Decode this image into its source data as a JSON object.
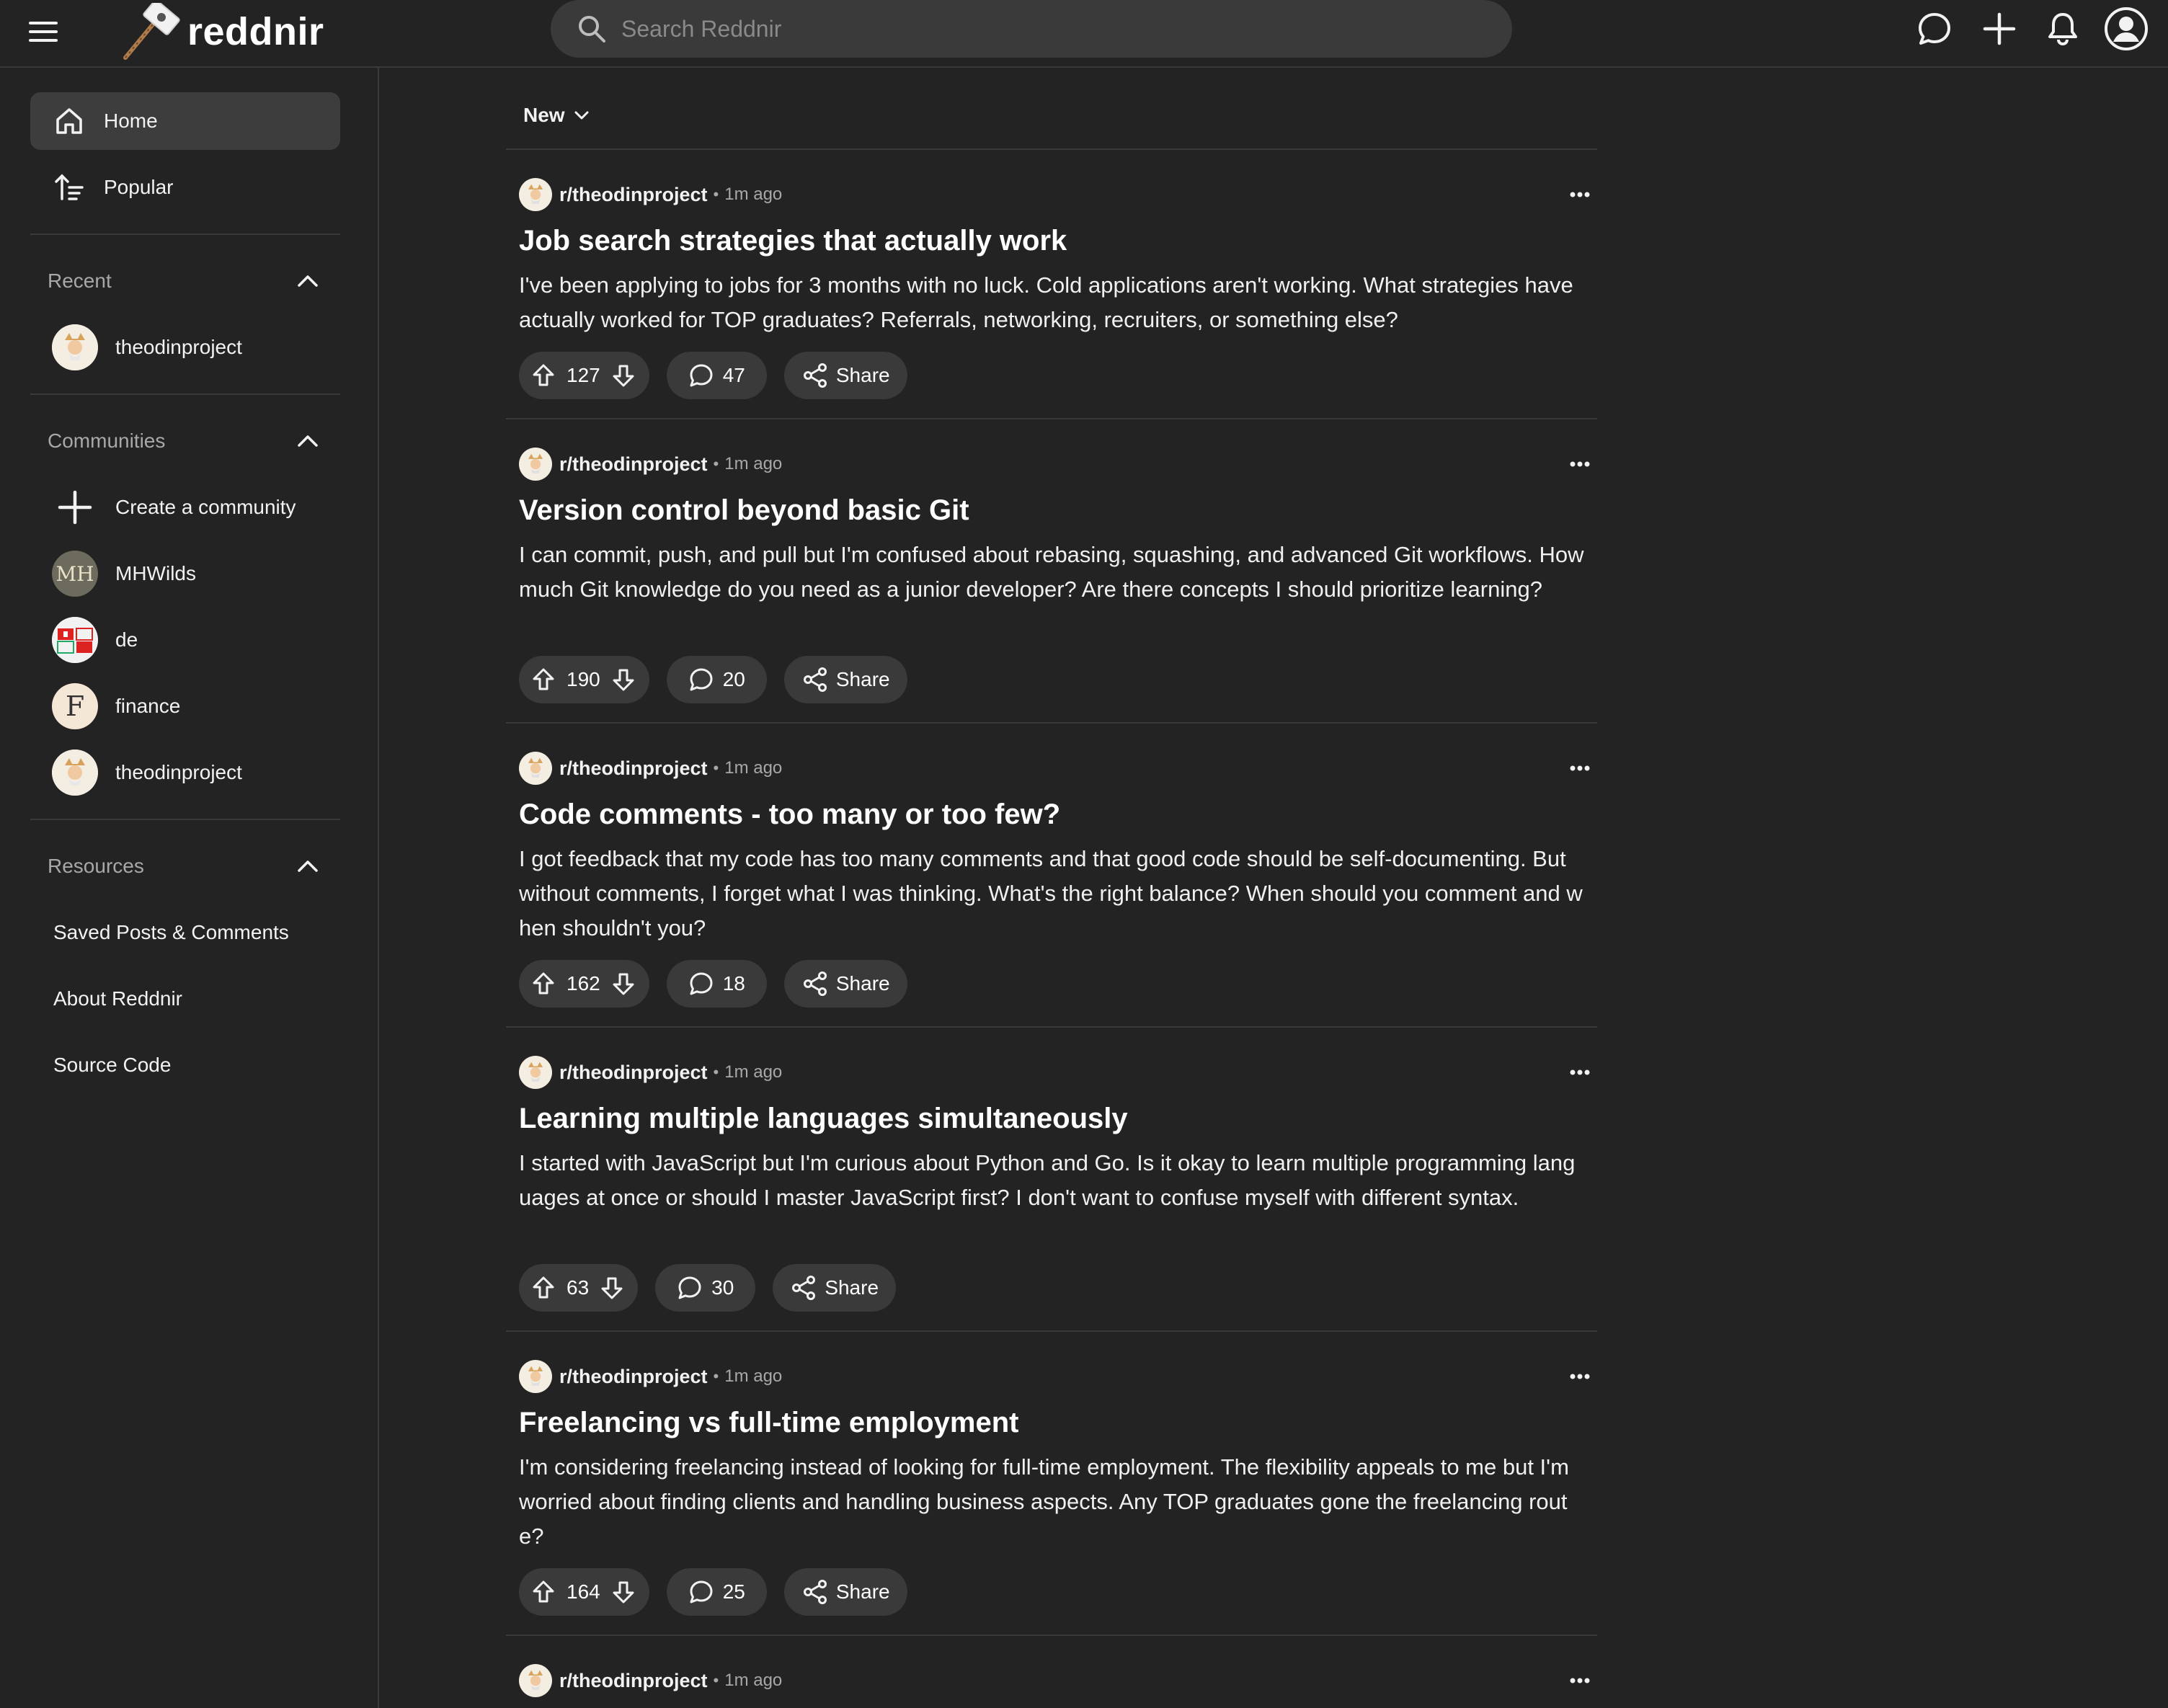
{
  "app": {
    "name": "reddnir"
  },
  "search": {
    "placeholder": "Search Reddnir"
  },
  "sidebar": {
    "nav": [
      {
        "label": "Home",
        "icon": "home-icon",
        "active": true
      },
      {
        "label": "Popular",
        "icon": "popular-icon",
        "active": false
      }
    ],
    "recent": {
      "heading": "Recent",
      "items": [
        {
          "label": "theodinproject",
          "avatar": "odin-avatar"
        }
      ]
    },
    "communities": {
      "heading": "Communities",
      "create_label": "Create a community",
      "items": [
        {
          "label": "MHWilds",
          "avatar_text": "MH"
        },
        {
          "label": "de",
          "avatar": "de-avatar"
        },
        {
          "label": "finance",
          "avatar_text": "F"
        },
        {
          "label": "theodinproject",
          "avatar": "odin-avatar"
        }
      ]
    },
    "resources": {
      "heading": "Resources",
      "items": [
        {
          "label": "Saved Posts & Comments"
        },
        {
          "label": "About Reddnir"
        },
        {
          "label": "Source Code"
        }
      ]
    }
  },
  "feed": {
    "sort_label": "New",
    "posts": [
      {
        "subreddit": "r/theodinproject",
        "time": "1m ago",
        "title": "Job search strategies that actually work",
        "body": "I've been applying to jobs for 3 months with no luck. Cold applications aren't working. What strategies have actually worked for TOP graduates? Referrals, networking, recruiters, or something else?",
        "votes": "127",
        "comments": "47",
        "share_label": "Share"
      },
      {
        "subreddit": "r/theodinproject",
        "time": "1m ago",
        "title": "Version control beyond basic Git",
        "body": "I can commit, push, and pull but I'm confused about rebasing, squashing, and advanced Git workflows. How much Git knowledge do you need as a junior developer? Are there concepts I should prioritize learning?",
        "votes": "190",
        "comments": "20",
        "share_label": "Share"
      },
      {
        "subreddit": "r/theodinproject",
        "time": "1m ago",
        "title": "Code comments - too many or too few?",
        "body": "I got feedback that my code has too many comments and that good code should be self-documenting. But without comments, I forget what I was thinking. What's the right balance? When should you comment and when shouldn't you?",
        "votes": "162",
        "comments": "18",
        "share_label": "Share"
      },
      {
        "subreddit": "r/theodinproject",
        "time": "1m ago",
        "title": "Learning multiple languages simultaneously",
        "body": "I started with JavaScript but I'm curious about Python and Go. Is it okay to learn multiple programming languages at once or should I master JavaScript first? I don't want to confuse myself with different syntax.",
        "votes": "63",
        "comments": "30",
        "share_label": "Share"
      },
      {
        "subreddit": "r/theodinproject",
        "time": "1m ago",
        "title": "Freelancing vs full-time employment",
        "body": "I'm considering freelancing instead of looking for full-time employment. The flexibility appeals to me but I'm worried about finding clients and handling business aspects. Any TOP graduates gone the freelancing route?",
        "votes": "164",
        "comments": "25",
        "share_label": "Share"
      },
      {
        "subreddit": "r/theodinproject",
        "time": "1m ago"
      }
    ]
  },
  "colors": {
    "background": "#232323",
    "surface": "#3a3a3a",
    "text": "#f2f2f2",
    "muted": "#a8a8a8"
  }
}
